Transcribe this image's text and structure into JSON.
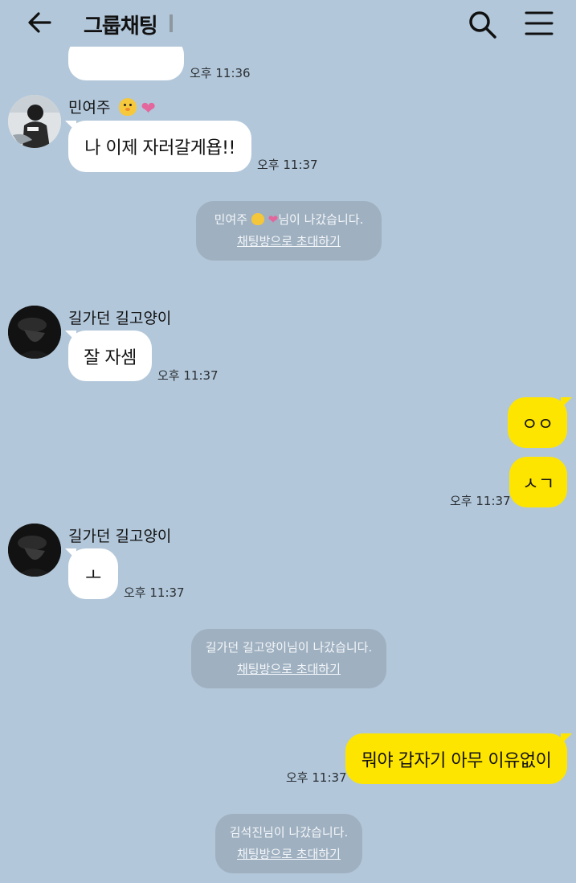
{
  "header": {
    "title": "그룹채팅",
    "icons": {
      "back": "arrow-left-icon",
      "search": "search-icon",
      "menu": "menu-icon"
    }
  },
  "colors": {
    "background": "#b2c7da",
    "my_bubble": "#fee500",
    "other_bubble": "#ffffff",
    "notice_bg": "#9fb0c0"
  },
  "messages": {
    "m0": {
      "text": "",
      "time": "오후 11:36"
    },
    "m1": {
      "sender": "민여주",
      "text": "나 이제 자러갈게욥!!",
      "time": "오후 11:37"
    },
    "n1": {
      "prefix": "민여주",
      "suffix": "님이 나갔습니다.",
      "invite": "채팅방으로 초대하기"
    },
    "m2": {
      "sender": "길가던 길고양이",
      "text": "잘 자셈",
      "time": "오후 11:37"
    },
    "m3": {
      "text": "ㅇㅇ"
    },
    "m4": {
      "text": "ㅅㄱ",
      "time": "오후 11:37"
    },
    "m5": {
      "sender": "길가던 길고양이",
      "text": "ㅗ",
      "time": "오후 11:37"
    },
    "n2": {
      "text": "길가던 길고양이님이 나갔습니다.",
      "invite": "채팅방으로 초대하기"
    },
    "m6": {
      "text": "뭐야 갑자기 아무 이유없이",
      "time": "오후 11:37"
    },
    "n3": {
      "text": "김석진님이 나갔습니다.",
      "invite": "채팅방으로 초대하기"
    }
  }
}
